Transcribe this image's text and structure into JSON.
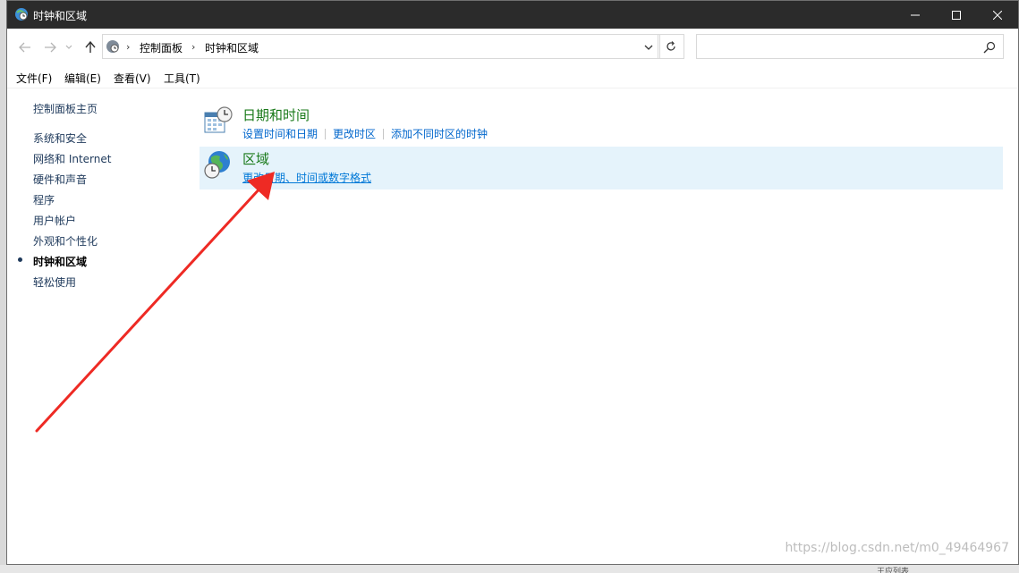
{
  "window": {
    "title": "时钟和区域",
    "minimize_icon": "minimize-icon",
    "maximize_icon": "maximize-icon",
    "close_icon": "close-icon"
  },
  "address": {
    "crumbs": [
      "控制面板",
      "时钟和区域"
    ],
    "search_placeholder": ""
  },
  "menu": {
    "items": [
      "文件(F)",
      "编辑(E)",
      "查看(V)",
      "工具(T)"
    ]
  },
  "sidebar": {
    "home": "控制面板主页",
    "items": [
      "系统和安全",
      "网络和 Internet",
      "硬件和声音",
      "程序",
      "用户帐户",
      "外观和个性化",
      "时钟和区域",
      "轻松使用"
    ],
    "current_index": 6
  },
  "categories": [
    {
      "title": "日期和时间",
      "icon": "calendar-clock-icon",
      "links": [
        "设置时间和日期",
        "更改时区",
        "添加不同时区的时钟"
      ]
    },
    {
      "title": "区域",
      "icon": "globe-clock-icon",
      "links": [
        "更改日期、时间或数字格式"
      ]
    }
  ],
  "watermark": "https://blog.csdn.net/m0_49464967",
  "taskbar_fragment": "王应列表",
  "colors": {
    "titlebar": "#2b2b2b",
    "category_title": "#1a7a1a",
    "link": "#0066cc",
    "hover_bg": "#e5f3fb",
    "annotation_arrow": "#ee2a24"
  }
}
